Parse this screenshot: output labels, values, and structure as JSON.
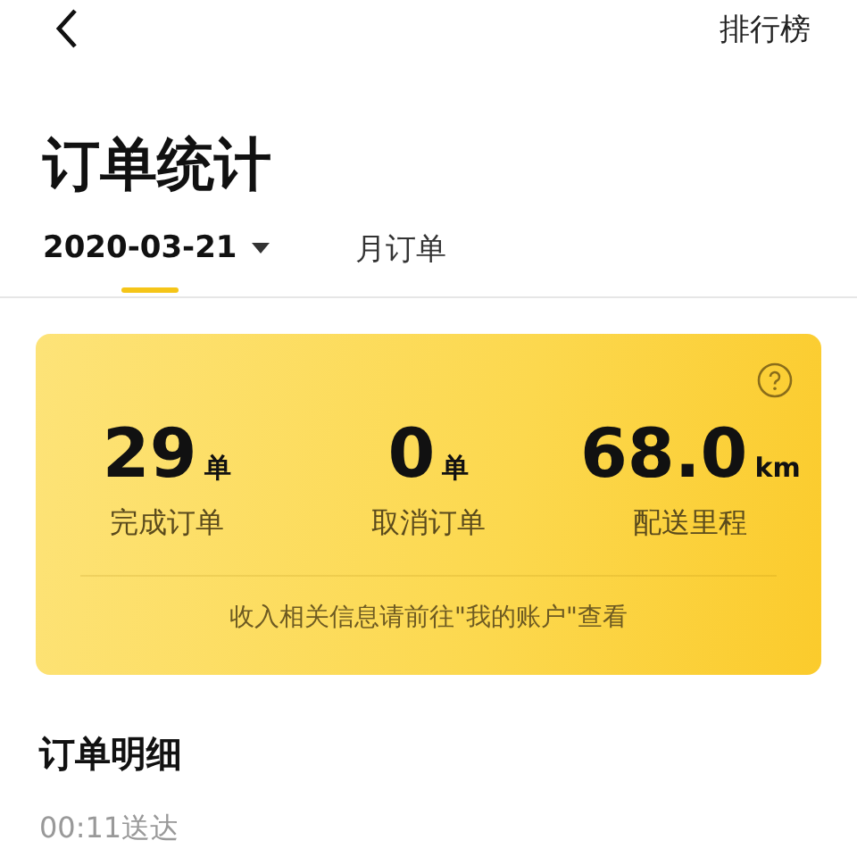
{
  "header": {
    "action": "排行榜"
  },
  "title": "订单统计",
  "tabs": [
    {
      "label": "2020-03-21",
      "kind": "dropdown",
      "selected": true
    },
    {
      "label": "月订单",
      "kind": "plain",
      "selected": false
    }
  ],
  "summary": {
    "stats": [
      {
        "value": "29",
        "unit": "单",
        "label": "完成订单"
      },
      {
        "value": "0",
        "unit": "单",
        "label": "取消订单"
      },
      {
        "value": "68.0",
        "unit": "km",
        "label": "配送里程"
      }
    ],
    "note": "收入相关信息请前往\"我的账户\"查看"
  },
  "details": {
    "heading": "订单明细",
    "orders": [
      {
        "time": "00:11送达"
      }
    ]
  }
}
